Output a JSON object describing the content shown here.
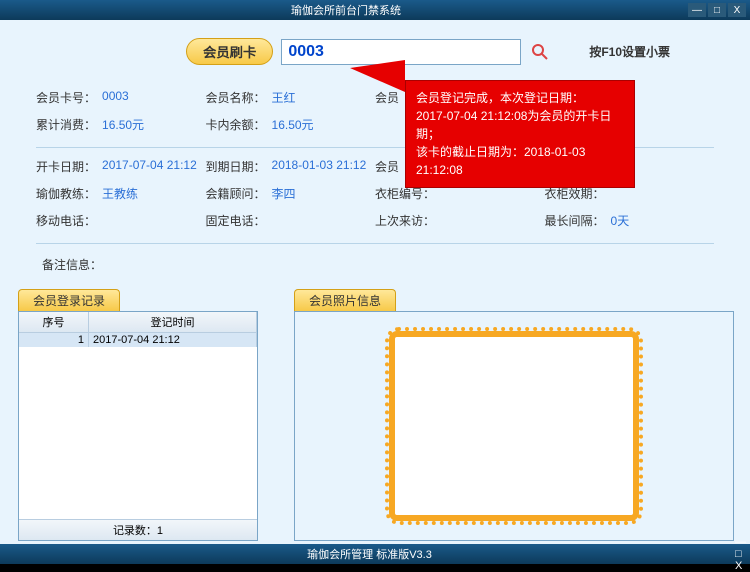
{
  "titlebar": {
    "title": "瑜伽会所前台门禁系统"
  },
  "wincontrols": {
    "min": "—",
    "max": "□",
    "close": "X"
  },
  "search": {
    "button": "会员刷卡",
    "value": "0003",
    "hint": "按F10设置小票"
  },
  "info": {
    "card_no_lbl": "会员卡号：",
    "card_no": "0003",
    "name_lbl": "会员名称：",
    "name": "王红",
    "member_lbl": "会员",
    "consume_lbl": "累计消费：",
    "consume": "16.50元",
    "balance_lbl": "卡内余额：",
    "balance": "16.50元",
    "open_date_lbl": "开卡日期：",
    "open_date": "2017-07-04 21:12",
    "expire_lbl": "到期日期：",
    "expire": "2018-01-03 21:12",
    "member2_lbl": "会员",
    "coach_lbl": "瑜伽教练：",
    "coach": "王教练",
    "advisor_lbl": "会籍顾问：",
    "advisor": "李四",
    "locker_no_lbl": "衣柜编号：",
    "locker_no": "",
    "locker_exp_lbl": "衣柜效期：",
    "locker_exp": "",
    "mobile_lbl": "移动电话：",
    "mobile": "",
    "tel_lbl": "固定电话：",
    "tel": "",
    "last_visit_lbl": "上次来访：",
    "last_visit": "",
    "max_gap_lbl": "最长间隔：",
    "max_gap": "0天",
    "remark_lbl": "备注信息："
  },
  "popup": {
    "line1": "会员登记完成，本次登记日期：",
    "line2": "2017-07-04 21:12:08为会员的开卡日期；",
    "line3": "该卡的截止日期为：2018-01-03 21:12:08"
  },
  "left_panel": {
    "tab": "会员登录记录",
    "col1": "序号",
    "col2": "登记时间",
    "row1_idx": "1",
    "row1_time": "2017-07-04 21:12",
    "footer": "记录数：1"
  },
  "right_panel": {
    "tab": "会员照片信息"
  },
  "bottom_titlebar": {
    "title": "瑜伽会所管理 标准版V3.3"
  }
}
